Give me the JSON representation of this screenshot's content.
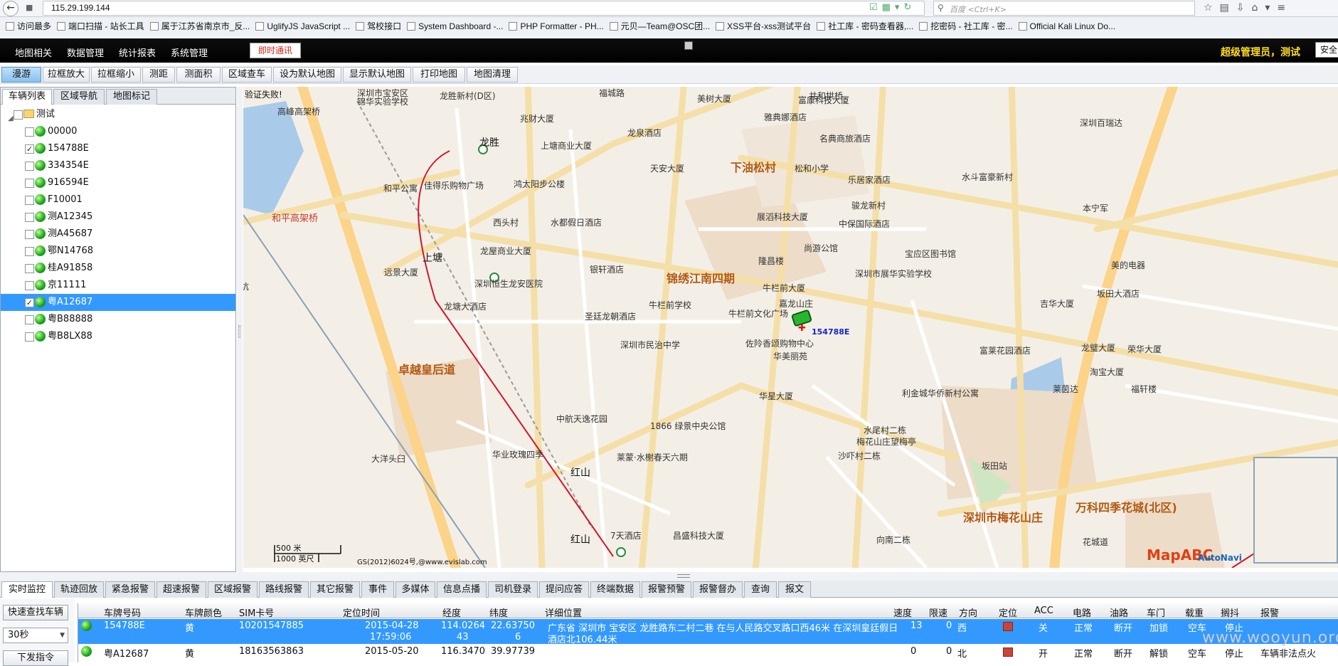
{
  "browser": {
    "url": "115.29.199.144",
    "search_placeholder": "百度 <Ctrl+K>",
    "bookmarks": [
      "访问最多",
      "端口扫描 - 站长工具",
      "属于江苏省南京市_反...",
      "UglifyJS JavaScript ...",
      "驾校接口",
      "System Dashboard -...",
      "PHP Formatter - PH...",
      "元贝—Team@OSC团...",
      "XSS平台-xss测试平台",
      "社工库 - 密码查看器,...",
      "挖密码 - 社工库 - 密...",
      "Official Kali Linux Do..."
    ]
  },
  "app_menu": {
    "items": [
      "地图相关",
      "数据管理",
      "统计报表",
      "系统管理"
    ],
    "notify_label": "即时通讯",
    "user": "超级管理员，测试",
    "safe_label": "安全"
  },
  "toolbar": {
    "buttons": [
      "漫游",
      "拉框放大",
      "拉框缩小",
      "测距",
      "测面积",
      "区域查车",
      "设为默认地图",
      "显示默认地图",
      "打印地图",
      "地图清理"
    ],
    "active_index": 0
  },
  "left_panel": {
    "tabs": [
      "车辆列表",
      "区域导航",
      "地图标记"
    ],
    "group_name": "测试",
    "vehicles": [
      {
        "plate": "00000",
        "checked": false,
        "selected": false
      },
      {
        "plate": "154788E",
        "checked": true,
        "selected": false
      },
      {
        "plate": "334354E",
        "checked": false,
        "selected": false
      },
      {
        "plate": "916594E",
        "checked": false,
        "selected": false
      },
      {
        "plate": "F10001",
        "checked": false,
        "selected": false
      },
      {
        "plate": "测A12345",
        "checked": false,
        "selected": false
      },
      {
        "plate": "测A45687",
        "checked": false,
        "selected": false
      },
      {
        "plate": "鄂N14768",
        "checked": false,
        "selected": false
      },
      {
        "plate": "桂A91858",
        "checked": false,
        "selected": false
      },
      {
        "plate": "京11111",
        "checked": false,
        "selected": false
      },
      {
        "plate": "粤A12687",
        "checked": true,
        "selected": true
      },
      {
        "plate": "粤B88888",
        "checked": false,
        "selected": false
      },
      {
        "plate": "粤B8LX88",
        "checked": false,
        "selected": false
      }
    ]
  },
  "map": {
    "validate_msg": "验证失败!",
    "car_label": "154788E",
    "scale_top": "500 米",
    "scale_bottom": "1000 英尺",
    "copyright": "GS(2012)6024号,@www.evislab.com",
    "logo": "MapABC",
    "provider": "AutoNavi",
    "labels": [
      {
        "t": "深圳市宝安区",
        "c": "mlabel"
      },
      {
        "t": "锦华实验学校",
        "c": "mlabel"
      },
      {
        "t": "龙胜新村(D区)",
        "c": "mlabel"
      },
      {
        "t": "福城路",
        "c": "mlabel"
      },
      {
        "t": "共和拱桥",
        "c": "mlabel"
      },
      {
        "t": "高峰高架桥",
        "c": "mlabel"
      },
      {
        "t": "美树大厦",
        "c": "mlabel"
      },
      {
        "t": "富康科技大厦",
        "c": "mlabel"
      },
      {
        "t": "兆财大厦",
        "c": "mlabel"
      },
      {
        "t": "雅典娜酒店",
        "c": "mlabel"
      },
      {
        "t": "龙胜",
        "c": "mlabel station"
      },
      {
        "t": "龙泉酒店",
        "c": "mlabel"
      },
      {
        "t": "名典商旅酒店",
        "c": "mlabel"
      },
      {
        "t": "上塘商业大厦",
        "c": "mlabel"
      },
      {
        "t": "下油松村",
        "c": "mlabel big"
      },
      {
        "t": "天安大厦",
        "c": "mlabel"
      },
      {
        "t": "松和小学",
        "c": "mlabel"
      },
      {
        "t": "深圳百瑞达",
        "c": "mlabel"
      },
      {
        "t": "和平公寓",
        "c": "mlabel"
      },
      {
        "t": "佳得乐购物广场",
        "c": "mlabel"
      },
      {
        "t": "鸿太阳步公楼",
        "c": "mlabel"
      },
      {
        "t": "乐居家酒店",
        "c": "mlabel"
      },
      {
        "t": "水斗富豪新村",
        "c": "mlabel"
      },
      {
        "t": "和平高架桥",
        "c": "mlabel red"
      },
      {
        "t": "骏龙新村",
        "c": "mlabel"
      },
      {
        "t": "西头村",
        "c": "mlabel"
      },
      {
        "t": "水都假日酒店",
        "c": "mlabel"
      },
      {
        "t": "展滔科技大厦",
        "c": "mlabel"
      },
      {
        "t": "中保国际酒店",
        "c": "mlabel"
      },
      {
        "t": "本宁军",
        "c": "mlabel"
      },
      {
        "t": "尚游公馆",
        "c": "mlabel"
      },
      {
        "t": "宝应区图书馆",
        "c": "mlabel"
      },
      {
        "t": "龙屋商业大厦",
        "c": "mlabel"
      },
      {
        "t": "上塘",
        "c": "mlabel station"
      },
      {
        "t": "锦绣江南四期",
        "c": "mlabel big"
      },
      {
        "t": "隆昌楼",
        "c": "mlabel"
      },
      {
        "t": "远景大厦",
        "c": "mlabel"
      },
      {
        "t": "银轩酒店",
        "c": "mlabel"
      },
      {
        "t": "深圳市展华实验学校",
        "c": "mlabel"
      },
      {
        "t": "美的电器",
        "c": "mlabel"
      },
      {
        "t": "深圳恒生龙安医院",
        "c": "mlabel"
      },
      {
        "t": "牛栏前大厦",
        "c": "mlabel"
      },
      {
        "t": "坂田大酒店",
        "c": "mlabel"
      },
      {
        "t": "大坑",
        "c": "mlabel"
      },
      {
        "t": "牛栏前学校",
        "c": "mlabel"
      },
      {
        "t": "嘉龙山庄",
        "c": "mlabel"
      },
      {
        "t": "吉华大厦",
        "c": "mlabel"
      },
      {
        "t": "龙塘大酒店",
        "c": "mlabel"
      },
      {
        "t": "圣廷龙朝酒店",
        "c": "mlabel"
      },
      {
        "t": "牛栏前文化广场",
        "c": "mlabel"
      },
      {
        "t": "深圳市民治中学",
        "c": "mlabel"
      },
      {
        "t": "华美丽苑",
        "c": "mlabel"
      },
      {
        "t": "富莱花园酒店",
        "c": "mlabel"
      },
      {
        "t": "龙璧大厦",
        "c": "mlabel"
      },
      {
        "t": "荣华大厦",
        "c": "mlabel"
      },
      {
        "t": "卓越皇后道",
        "c": "mlabel big"
      },
      {
        "t": "佐阾香颂购物中心",
        "c": "mlabel"
      },
      {
        "t": "淘宝大厦",
        "c": "mlabel"
      },
      {
        "t": "华星大厦",
        "c": "mlabel"
      },
      {
        "t": "利金城华侨新村公寓",
        "c": "mlabel"
      },
      {
        "t": "莱茵达",
        "c": "mlabel"
      },
      {
        "t": "福轩楼",
        "c": "mlabel"
      },
      {
        "t": "中航天逸花园",
        "c": "mlabel"
      },
      {
        "t": "1866 绿景中央公馆",
        "c": "mlabel"
      },
      {
        "t": "水尾村二栋",
        "c": "mlabel"
      },
      {
        "t": "梅花山庄望梅亭",
        "c": "mlabel"
      },
      {
        "t": "华业玫瑰四季",
        "c": "mlabel"
      },
      {
        "t": "莱蒙·水榭春天六期",
        "c": "mlabel"
      },
      {
        "t": "沙吓村二栋",
        "c": "mlabel"
      },
      {
        "t": "坂田站",
        "c": "mlabel"
      },
      {
        "t": "大洋头臼",
        "c": "mlabel"
      },
      {
        "t": "红山",
        "c": "mlabel station"
      },
      {
        "t": "深圳市梅花山庄",
        "c": "mlabel big"
      },
      {
        "t": "万科四季花城(北区)",
        "c": "mlabel big"
      },
      {
        "t": "7天酒店",
        "c": "mlabel"
      },
      {
        "t": "昌盛科技大厦",
        "c": "mlabel"
      },
      {
        "t": "红山",
        "c": "mlabel station"
      },
      {
        "t": "向南二栋",
        "c": "mlabel"
      },
      {
        "t": "花城道",
        "c": "mlabel"
      }
    ]
  },
  "bottom_tabs": [
    "实时监控",
    "轨迹回放",
    "紧急报警",
    "超速报警",
    "区域报警",
    "路线报警",
    "其它报警",
    "事件",
    "多媒体",
    "信息点播",
    "司机登录",
    "提问应答",
    "终端数据",
    "报警预警",
    "报警督办",
    "查询",
    "报文"
  ],
  "bottom_left": {
    "search_btn": "快速查找车辆",
    "interval": "30秒",
    "send_btn": "下发指令"
  },
  "grid": {
    "columns": [
      "车牌号码",
      "车牌颜色",
      "SIM卡号",
      "定位时间",
      "经度",
      "纬度",
      "详细位置",
      "速度",
      "限速",
      "方向",
      "定位",
      "ACC",
      "电路",
      "油路",
      "车门",
      "载重",
      "搁抖",
      "报警"
    ],
    "rows": [
      {
        "plate": "154788E",
        "color": "黄",
        "sim": "10201547885",
        "time1": "2015-04-28",
        "time2": "17:59:06",
        "lng1": "114.0264",
        "lng2": "43",
        "lat1": "22.63750",
        "lat2": "6",
        "addr1": "广东省 深圳市 宝安区 龙胜路东二村二巷 在与人民路交叉路口西46米 在深圳皇廷假日",
        "addr2": "酒店北106.44米",
        "speed": "13",
        "limit": "0",
        "dir": "西",
        "acc": "关",
        "circuit": "正常",
        "oil": "断开",
        "door": "加锁",
        "load": "空车",
        "shake": "停止",
        "alarm": "",
        "selected": true
      },
      {
        "plate": "粤A12687",
        "color": "黄",
        "sim": "18163563863",
        "time1": "2015-05-20",
        "time2": "",
        "lng1": "116.3470",
        "lng2": "",
        "lat1": "39.97739",
        "lat2": "",
        "addr1": "",
        "addr2": "",
        "speed": "0",
        "limit": "0",
        "dir": "北",
        "acc": "开",
        "circuit": "正常",
        "oil": "断开",
        "door": "解锁",
        "load": "空车",
        "shake": "停止",
        "alarm": "车辆非法点火",
        "selected": false
      }
    ]
  },
  "watermark": "www.wooyun.org"
}
